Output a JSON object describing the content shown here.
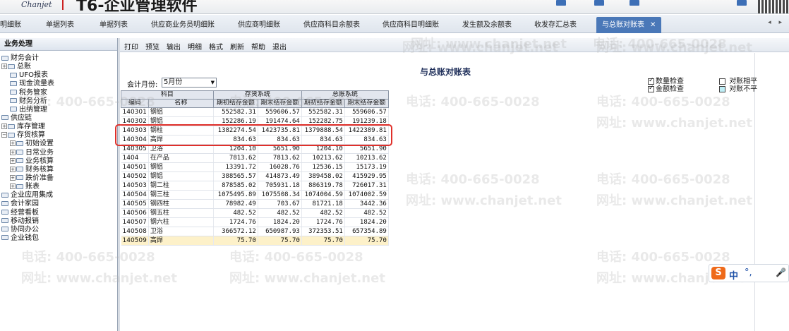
{
  "header": {
    "logo_text": "Chanjet",
    "product_title": "T6-企业管理软件"
  },
  "tabs": [
    {
      "label": "明细账"
    },
    {
      "label": "单据列表"
    },
    {
      "label": "单据列表"
    },
    {
      "label": "供应商业务员明细账"
    },
    {
      "label": "供应商明细账"
    },
    {
      "label": "供应商科目余额表"
    },
    {
      "label": "供应商科目明细账"
    },
    {
      "label": "发生额及余额表"
    },
    {
      "label": "收发存汇总表"
    },
    {
      "label": "与总账对账表",
      "close": "✕"
    }
  ],
  "tab_nav": "◂ ▸",
  "sidebar": {
    "title": "业务处理",
    "items": [
      {
        "label": "财务会计",
        "expander": ""
      },
      {
        "label": "总账",
        "expander": "+"
      },
      {
        "label": "UFO报表",
        "expander": ""
      },
      {
        "label": "现金流量表",
        "expander": ""
      },
      {
        "label": "税务管家",
        "expander": ""
      },
      {
        "label": "财务分析",
        "expander": ""
      },
      {
        "label": "出纳管理",
        "expander": ""
      },
      {
        "label": "供应链",
        "expander": ""
      },
      {
        "label": "库存管理",
        "expander": "+"
      },
      {
        "label": "存货核算",
        "expander": "−"
      },
      {
        "label": "初始设置",
        "expander": "+"
      },
      {
        "label": "日常业务",
        "expander": "+"
      },
      {
        "label": "业务核算",
        "expander": "+"
      },
      {
        "label": "财务核算",
        "expander": "+"
      },
      {
        "label": "跌价准备",
        "expander": "+"
      },
      {
        "label": "账表",
        "expander": "+"
      },
      {
        "label": "企业应用集成",
        "expander": ""
      },
      {
        "label": "会计家园",
        "expander": ""
      },
      {
        "label": "经营看板",
        "expander": ""
      },
      {
        "label": "移动报销",
        "expander": ""
      },
      {
        "label": "协同办公",
        "expander": ""
      },
      {
        "label": "企业钱包",
        "expander": ""
      }
    ]
  },
  "toolbar": {
    "print": "打印",
    "preview": "预览",
    "export": "输出",
    "detail": "明细",
    "format": "格式",
    "refresh": "刷新",
    "help": "帮助",
    "exit": "退出"
  },
  "report": {
    "title": "与总账对账表",
    "period_label": "会计月份:",
    "period_value": "5月份",
    "checks": {
      "quantity_check": "数量检查",
      "amount_check": "金额检查",
      "balanced": "对账相平",
      "unbalanced": "对账不平"
    }
  },
  "table": {
    "group_headers": {
      "subject": "科目",
      "inventory": "存货系统",
      "ledger": "总账系统"
    },
    "columns": [
      "编码",
      "名称",
      "期初结存金额",
      "期末结存金额",
      "期初结存金额",
      "期末结存金额"
    ],
    "rows": [
      [
        "140301",
        "钢铝",
        "552582.31",
        "559606.57",
        "552582.31",
        "559606.57"
      ],
      [
        "140302",
        "钢铝",
        "152286.19",
        "191474.64",
        "152282.75",
        "191239.18"
      ],
      [
        "140303",
        "钢柱",
        "1382274.54",
        "1423735.81",
        "1379888.54",
        "1422389.81"
      ],
      [
        "140304",
        "高焊",
        "834.63",
        "834.63",
        "834.63",
        "834.63"
      ],
      [
        "140305",
        "卫浴",
        "1204.10",
        "5651.90",
        "1204.10",
        "5651.90"
      ],
      [
        "1404",
        "在产品",
        "7813.62",
        "7813.62",
        "10213.62",
        "10213.62"
      ],
      [
        "140501",
        "钢铝",
        "13391.72",
        "16028.76",
        "12536.15",
        "15173.19"
      ],
      [
        "140502",
        "钢铝",
        "388565.57",
        "414873.49",
        "389458.02",
        "415929.95"
      ],
      [
        "140503",
        "钢二柱",
        "878585.02",
        "705931.18",
        "886319.78",
        "726017.31"
      ],
      [
        "140504",
        "钢三柱",
        "1075495.89",
        "1075508.34",
        "1074004.59",
        "1074002.59"
      ],
      [
        "140505",
        "钢四柱",
        "78982.49",
        "703.67",
        "81721.18",
        "3442.36"
      ],
      [
        "140506",
        "钢五柱",
        "482.52",
        "482.52",
        "482.52",
        "482.52"
      ],
      [
        "140507",
        "钢六柱",
        "1724.76",
        "1824.20",
        "1724.76",
        "1824.20"
      ],
      [
        "140508",
        "卫浴",
        "366572.12",
        "650987.93",
        "372353.51",
        "657354.89"
      ],
      [
        "140509",
        "高焊",
        "75.70",
        "75.70",
        "75.70",
        "75.70"
      ]
    ]
  },
  "watermark": {
    "phone": "电话: 400-665-0028",
    "url": "网址: www.chanjet.net"
  },
  "ime": {
    "logo": "S",
    "mode": "中",
    "punct": "°,",
    "mic": "🎤"
  },
  "colors": {
    "active_tab": "#4a78b8",
    "highlight": "#e0302a",
    "total_row": "#fdf1c9",
    "unbalanced_box": "#bfeef6"
  }
}
